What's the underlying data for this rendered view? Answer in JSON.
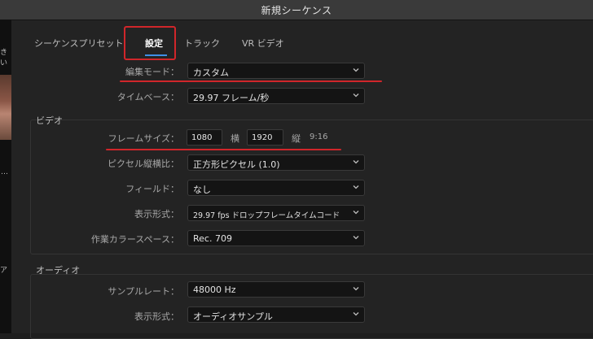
{
  "window": {
    "title": "新規シーケンス"
  },
  "left_strip": {
    "text1": "きい",
    "text2": "…",
    "text3": "ア"
  },
  "tabs": [
    {
      "label": "シーケンスプリセット"
    },
    {
      "label": "設定"
    },
    {
      "label": "トラック"
    },
    {
      "label": "VR ビデオ"
    }
  ],
  "general": {
    "edit_mode": {
      "label": "編集モード：",
      "value": "カスタム"
    },
    "timebase": {
      "label": "タイムベース：",
      "value": "29.97  フレーム/秒"
    }
  },
  "video": {
    "section_title": "ビデオ",
    "frame_size": {
      "label": "フレームサイズ：",
      "width": "1080",
      "width_label": "横",
      "height": "1920",
      "height_label": "縦",
      "aspect": "9:16"
    },
    "pixel_aspect": {
      "label": "ピクセル縦横比：",
      "value": "正方形ピクセル (1.0)"
    },
    "fields": {
      "label": "フィールド：",
      "value": "なし"
    },
    "display_format": {
      "label": "表示形式：",
      "value": "29.97 fps ドロップフレームタイムコード"
    },
    "working_color_space": {
      "label": "作業カラースペース：",
      "value": "Rec. 709"
    }
  },
  "audio": {
    "section_title": "オーディオ",
    "sample_rate": {
      "label": "サンプルレート：",
      "value": "48000 Hz"
    },
    "display_format": {
      "label": "表示形式：",
      "value": "オーディオサンプル"
    }
  },
  "colors": {
    "annotation_red": "#d0262a",
    "tab_underline": "#3f8fe6"
  }
}
